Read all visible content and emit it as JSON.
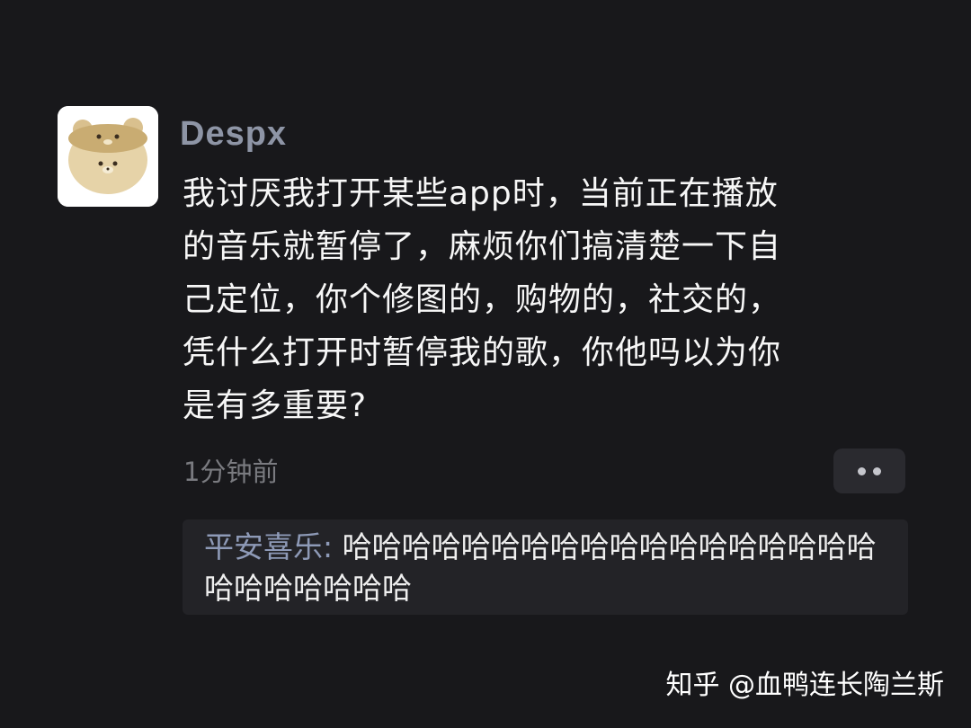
{
  "post": {
    "username": "Despx",
    "message_lines": [
      "我讨厌我打开某些app时，当前正在播放",
      "的音乐就暂停了，麻烦你们搞清楚一下自",
      "己定位，你个修图的，购物的，社交的，",
      "凭什么打开时暂停我的歌，你他吗以为你",
      "是有多重要?"
    ],
    "timestamp": "1分钟前",
    "more_icon": "more-dots-icon"
  },
  "reply": {
    "author": "平安喜乐",
    "separator": ": ",
    "text": "哈哈哈哈哈哈哈哈哈哈哈哈哈哈哈哈哈哈哈哈哈哈哈哈哈"
  },
  "watermark": "知乎 @血鸭连长陶兰斯",
  "colors": {
    "background": "#18181b",
    "username": "#8e95a6",
    "reply_author": "#8e9ab7",
    "muted": "#7a7b80"
  }
}
